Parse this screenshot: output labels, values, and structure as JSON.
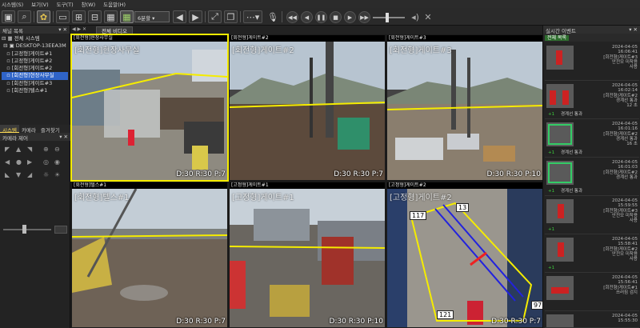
{
  "menu": {
    "items": [
      "시스템(S)",
      "보기(V)",
      "도구(T)",
      "창(W)",
      "도움말(H)"
    ]
  },
  "toolbar": {
    "layout_select": "6분할"
  },
  "left_panel": {
    "title": "채널 목록",
    "tree": [
      "전체 시스템",
      "DESKTOP-13EEA3M",
      "[고정형]게이트#1",
      "[고정형]게이트#2",
      "[회전형]게이트#2",
      "[회전형]현장사무실",
      "[회전형]게이트#3",
      "[회전형]텔스#1"
    ],
    "tabs": [
      "시스템",
      "카메라",
      "즐겨찾기"
    ],
    "camera_control_title": "카메라 제어"
  },
  "center": {
    "tab": "전체 비디오",
    "tiles": [
      {
        "header": "[회전형]현장사무실",
        "name": "[회전형]현장사무실",
        "stat": "D:30 R:30 P:7",
        "selected": true
      },
      {
        "header": "[회전형]게이트#2",
        "name": "[회전형]게이트#2",
        "stat": "D:30 R:30 P:7",
        "selected": false
      },
      {
        "header": "[회전형]게이트#3",
        "name": "[회전형]게이트#3",
        "stat": "D:30 R:30 P:10",
        "selected": false
      },
      {
        "header": "[회전형]텔스#1",
        "name": "[회전형]텔스#1",
        "stat": "D:30 R:30 P:7",
        "selected": false
      },
      {
        "header": "[고정형]게이트#1",
        "name": "[고정형]게이트#1",
        "stat": "D:30 R:30 P:10",
        "selected": false
      },
      {
        "header": "[고정형]게이트#2",
        "name": "[고정형]게이트#2",
        "stat": "D:30 R:30 P:7",
        "selected": false
      }
    ],
    "counts": {
      "a": "117",
      "b": "13",
      "c": "97",
      "d": "121"
    }
  },
  "right_panel": {
    "title": "실시간 이벤트",
    "subtab": "전체 목록",
    "events": [
      {
        "date": "2024-04-05",
        "time": "16:06:41",
        "cam": "[회전형]게이트#3",
        "type": "안전모 미착용",
        "extra": "사용",
        "label": "",
        "count": ""
      },
      {
        "date": "2024-04-05",
        "time": "16:02:14",
        "cam": "[회전형]게이트#2",
        "type": "경계선 통과",
        "extra": "12 초",
        "label": "경계선 통과",
        "count": "+1"
      },
      {
        "date": "2024-04-05",
        "time": "16:01:16",
        "cam": "[회전형]게이트#2",
        "type": "경계선 통과",
        "extra": "16 초",
        "label": "경계선 통과",
        "count": "+1"
      },
      {
        "date": "2024-04-05",
        "time": "16:01:03",
        "cam": "[회전형]게이트#2",
        "type": "경계선 통과",
        "extra": "",
        "label": "경계선 통과",
        "count": "+1"
      },
      {
        "date": "2024-04-05",
        "time": "15:59:55",
        "cam": "[회전형]게이트#3",
        "type": "안전모 미착용",
        "extra": "사용",
        "label": "",
        "count": "+1"
      },
      {
        "date": "2024-04-05",
        "time": "15:58:41",
        "cam": "[회전형]게이트#2",
        "type": "안전모 미착용",
        "extra": "사용",
        "label": "",
        "count": "+1"
      },
      {
        "date": "2024-04-05",
        "time": "15:56:41",
        "cam": "[회전형]게이트#1",
        "type": "쓰러짐 검지",
        "extra": "",
        "label": "",
        "count": ""
      },
      {
        "date": "2024-04-05",
        "time": "15:55:30",
        "cam": "",
        "type": "",
        "extra": "",
        "label": "",
        "count": ""
      }
    ]
  }
}
